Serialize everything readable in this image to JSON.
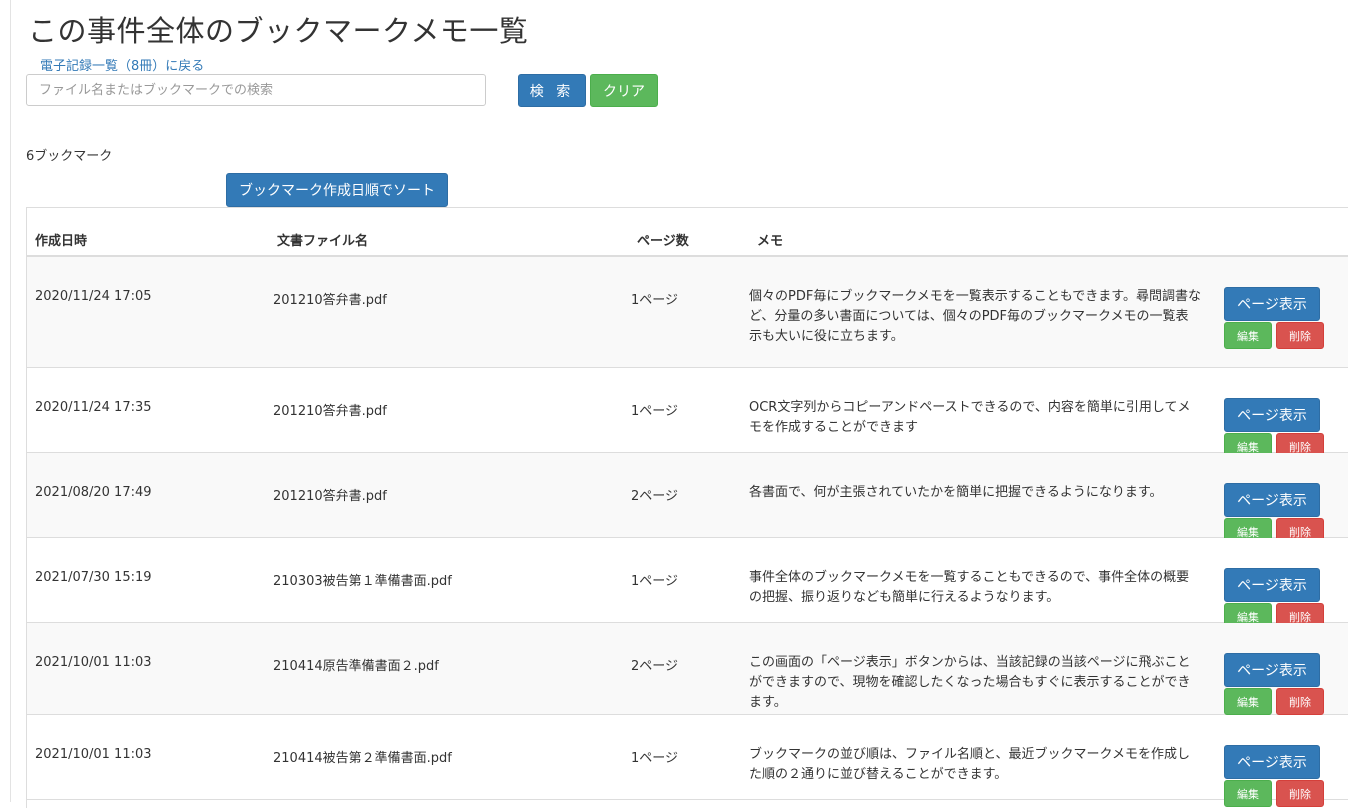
{
  "header": {
    "title": "この事件全体のブックマークメモ一覧",
    "back_link": "電子記録一覧（8冊）に戻る"
  },
  "search": {
    "placeholder": "ファイル名またはブックマークでの検索",
    "value": "",
    "search_label": "検 索",
    "clear_label": "クリア"
  },
  "summary": {
    "count_text": "6ブックマーク",
    "sort_label": "ブックマーク作成日順でソート"
  },
  "table": {
    "headers": {
      "created": "作成日時",
      "file": "文書ファイル名",
      "pages": "ページ数",
      "memo": "メモ"
    },
    "rows": [
      {
        "created": "2020/11/24 17:05",
        "file": "201210答弁書.pdf",
        "pages": "1ページ",
        "memo": "個々のPDF毎にブックマークメモを一覧表示することもできます。尋問調書など、分量の多い書面については、個々のPDF毎のブックマークメモの一覧表示も大いに役に立ちます。"
      },
      {
        "created": "2020/11/24 17:35",
        "file": "201210答弁書.pdf",
        "pages": "1ページ",
        "memo": "OCR文字列からコピーアンドペーストできるので、内容を簡単に引用してメモを作成することができます"
      },
      {
        "created": "2021/08/20 17:49",
        "file": "201210答弁書.pdf",
        "pages": "2ページ",
        "memo": "各書面で、何が主張されていたかを簡単に把握できるようになります。"
      },
      {
        "created": "2021/07/30 15:19",
        "file": "210303被告第１準備書面.pdf",
        "pages": "1ページ",
        "memo": "事件全体のブックマークメモを一覧することもできるので、事件全体の概要の把握、振り返りなども簡単に行えるようなります。"
      },
      {
        "created": "2021/10/01 11:03",
        "file": "210414原告準備書面２.pdf",
        "pages": "2ページ",
        "memo": "この画面の「ページ表示」ボタンからは、当該記録の当該ページに飛ぶことができますので、現物を確認したくなった場合もすぐに表示することができます。"
      },
      {
        "created": "2021/10/01 11:03",
        "file": "210414被告第２準備書面.pdf",
        "pages": "1ページ",
        "memo": "ブックマークの並び順は、ファイル名順と、最近ブックマークメモを作成した順の２通りに並び替えることができます。"
      }
    ],
    "actions": {
      "view_label": "ページ表示",
      "edit_label": "編集",
      "delete_label": "削除"
    }
  },
  "colors": {
    "primary": "#337ab7",
    "success": "#5cb85c",
    "danger": "#d9534f",
    "link": "#337ab7",
    "stripe": "#f9f9f9",
    "border": "#dddddd"
  }
}
